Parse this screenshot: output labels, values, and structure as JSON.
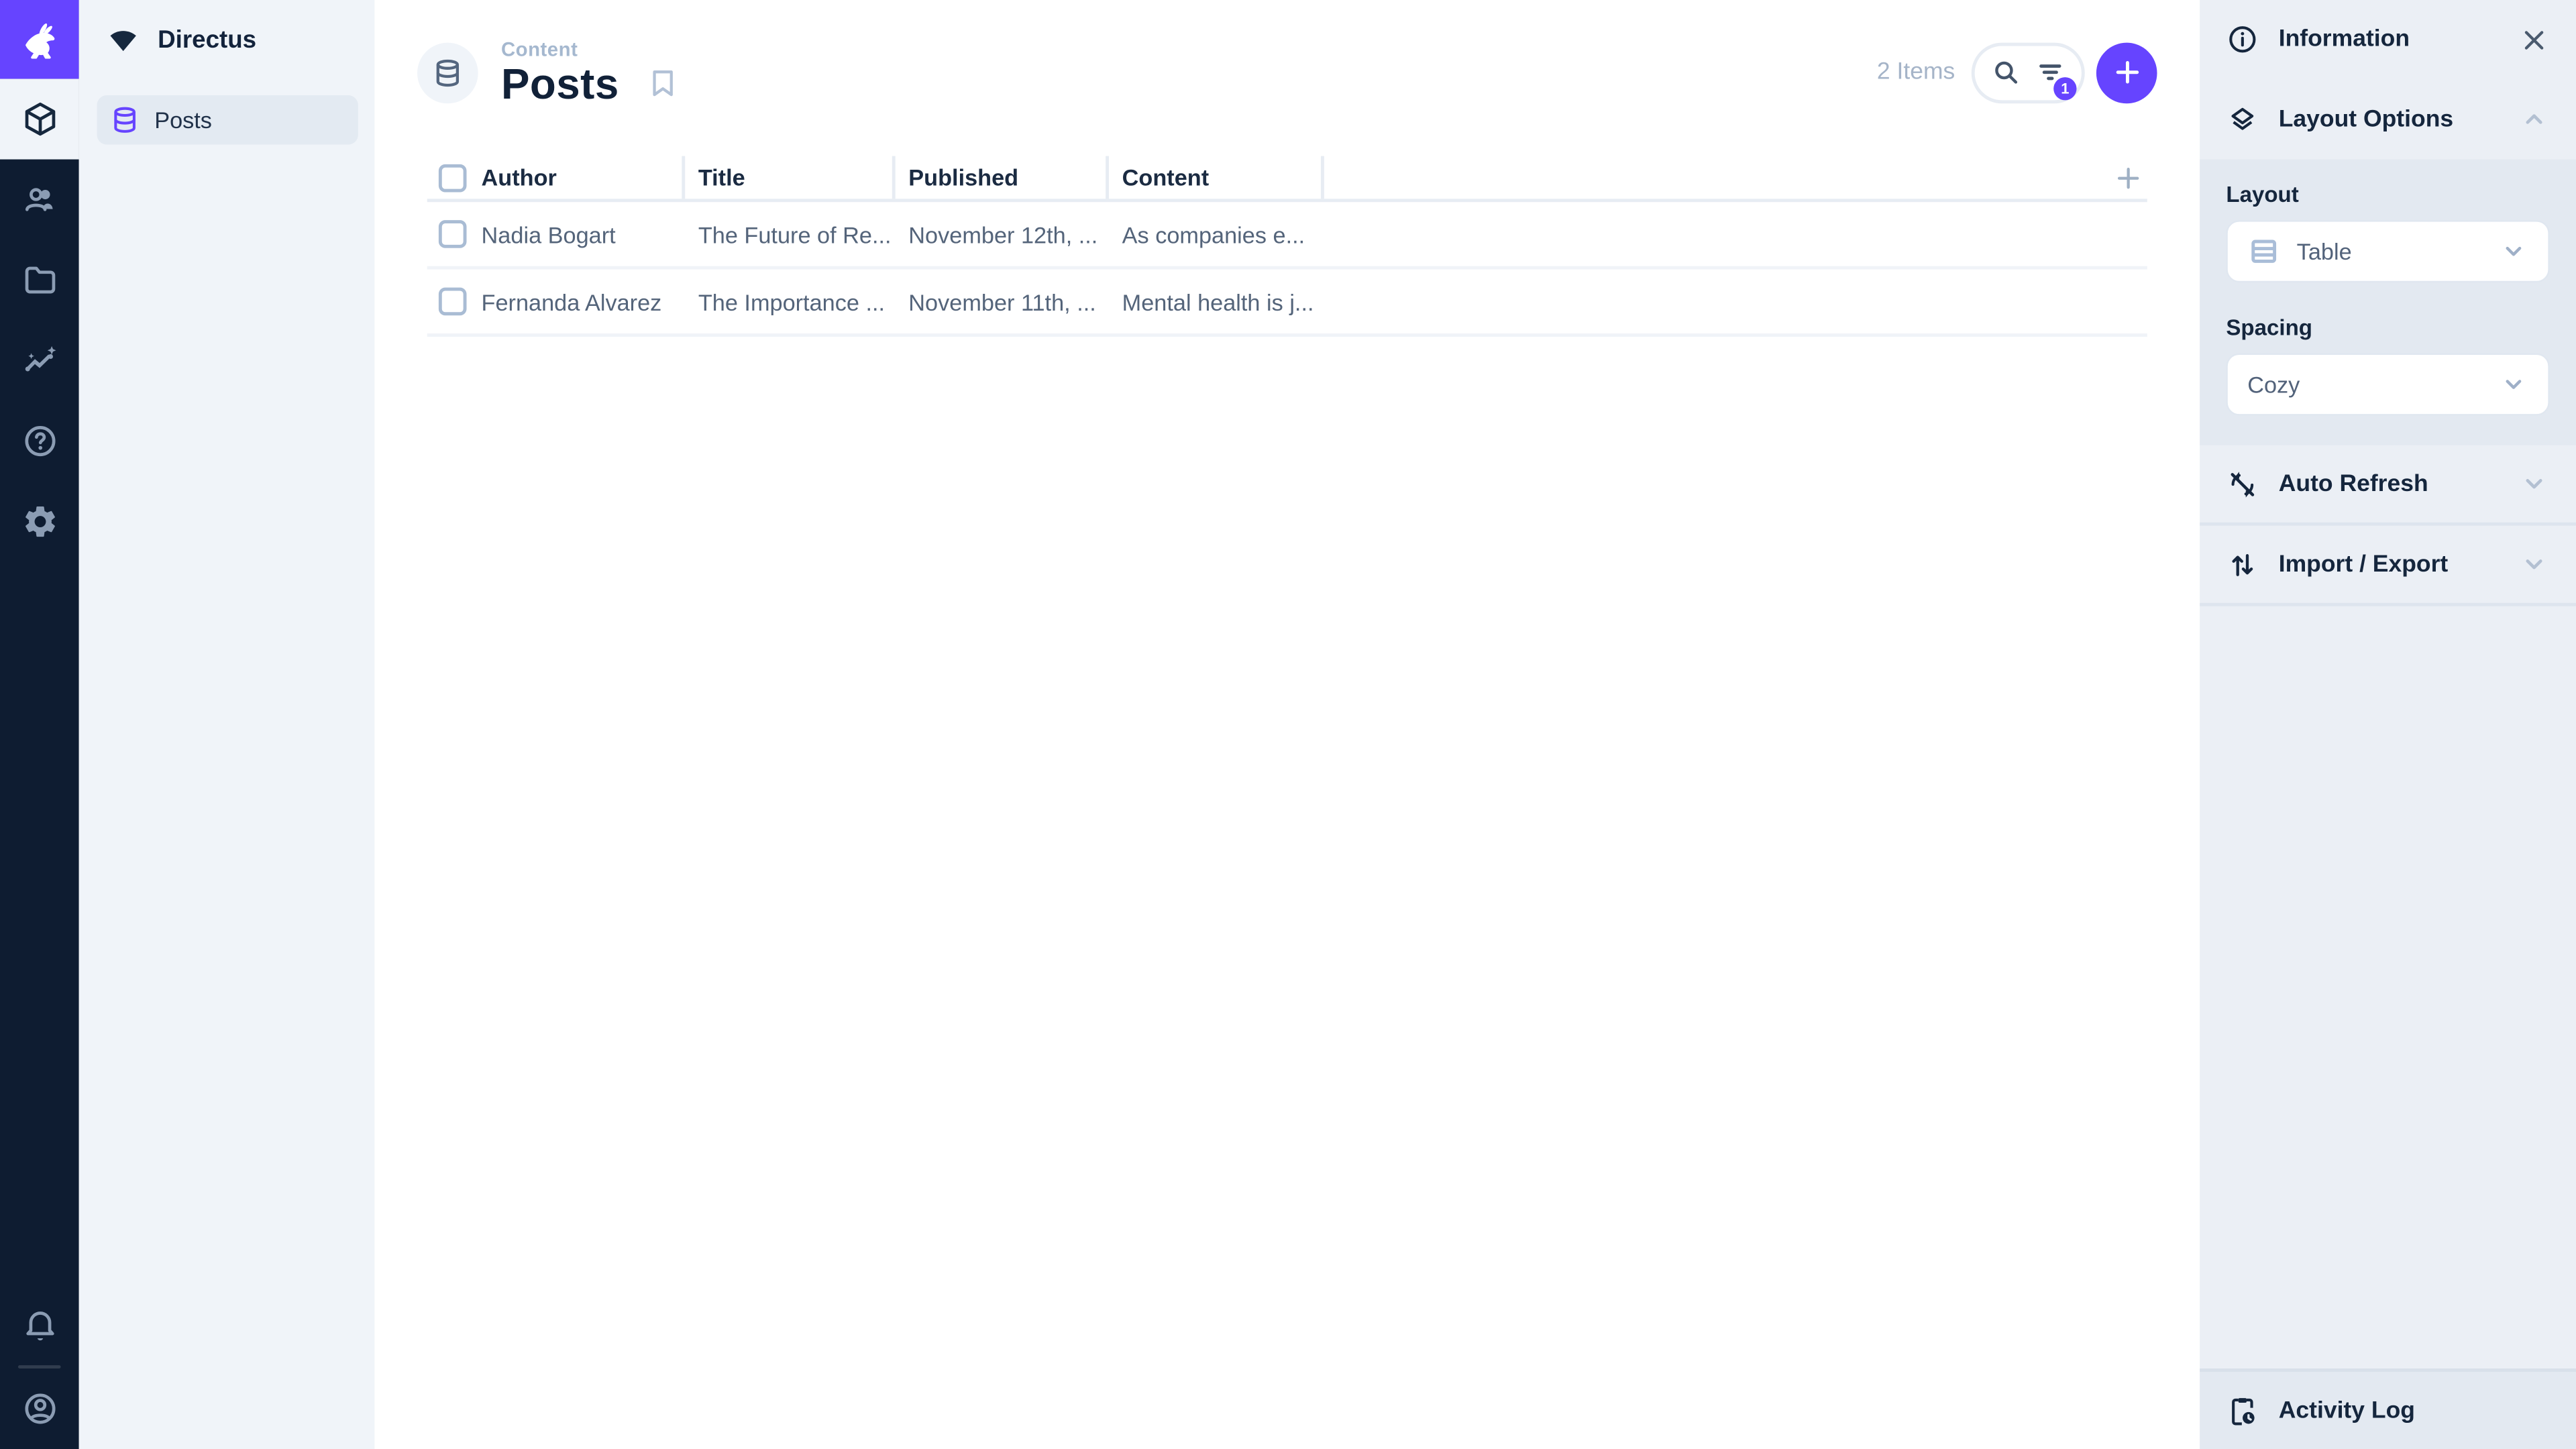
{
  "project": {
    "name": "Directus"
  },
  "colors": {
    "accent": "#6644ff",
    "module_bar_bg": "#0e1c31",
    "dark_text": "#13233c",
    "sidebar_bg": "#ebeff5"
  },
  "icons": [
    "directus-rabbit-logo",
    "wifi-signal-icon",
    "cube-icon",
    "users-icon",
    "folder-icon",
    "insights-icon",
    "help-icon",
    "gear-icon",
    "bell-icon",
    "account-circle-icon",
    "database-icon",
    "bookmark-icon",
    "search-icon",
    "filter-icon",
    "plus-icon",
    "info-icon",
    "close-icon",
    "layers-icon",
    "chevron-up-icon",
    "chevron-down-icon",
    "table-layout-icon",
    "sync-disabled-icon",
    "import-export-arrows-icon",
    "activity-log-clipboard-icon"
  ],
  "nav": {
    "items": [
      {
        "label": "Posts",
        "active": true
      }
    ]
  },
  "page_header": {
    "breadcrumb": "Content",
    "title": "Posts",
    "items_count": "2 Items",
    "filter_badge_count": "1"
  },
  "table": {
    "columns": [
      "Author",
      "Title",
      "Published",
      "Content"
    ],
    "rows": [
      {
        "author": "Nadia Bogart",
        "title": "The Future of Re...",
        "published": "November 12th, ...",
        "content": "As companies e..."
      },
      {
        "author": "Fernanda Alvarez",
        "title": "The Importance ...",
        "published": "November 11th, ...",
        "content": "Mental health is j..."
      }
    ]
  },
  "info_sidebar": {
    "title": "Information",
    "layout_options_label": "Layout Options",
    "layout_label": "Layout",
    "layout_value": "Table",
    "spacing_label": "Spacing",
    "spacing_value": "Cozy",
    "auto_refresh_label": "Auto Refresh",
    "import_export_label": "Import / Export",
    "activity_log_label": "Activity Log"
  }
}
